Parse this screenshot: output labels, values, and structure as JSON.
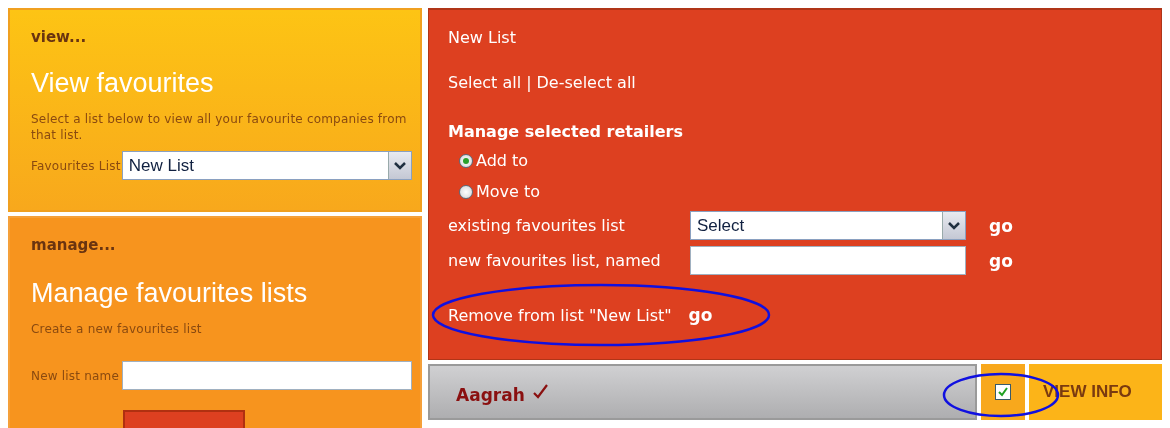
{
  "view_panel": {
    "label": "view...",
    "title": "View favourites",
    "description": "Select a list below to view all your favourite companies from that list.",
    "field_label": "Favourites List",
    "select_value": "New List"
  },
  "manage_panel": {
    "label": "manage...",
    "title": "Manage favourites lists",
    "subtitle": "Create a new favourites list",
    "field_label": "New list name"
  },
  "list_panel": {
    "title": "New List",
    "select_all": "Select all",
    "separator": "|",
    "deselect_all": "De-select all",
    "section_title": "Manage selected retailers",
    "options": [
      {
        "label": "Add to",
        "selected": true
      },
      {
        "label": "Move to",
        "selected": false
      }
    ],
    "targets": [
      {
        "kind": "select",
        "label": "existing favourites list",
        "value": "Select",
        "action": "go"
      },
      {
        "kind": "text",
        "label": "new favourites list, named",
        "action": "go"
      }
    ],
    "remove": {
      "text": "Remove from list \"New List\"",
      "action": "go",
      "circled": true
    }
  },
  "retailers": [
    {
      "name": "Aagrah",
      "favourite": true,
      "checked": true,
      "checkbox_circled": true,
      "action": "VIEW INFO"
    }
  ]
}
